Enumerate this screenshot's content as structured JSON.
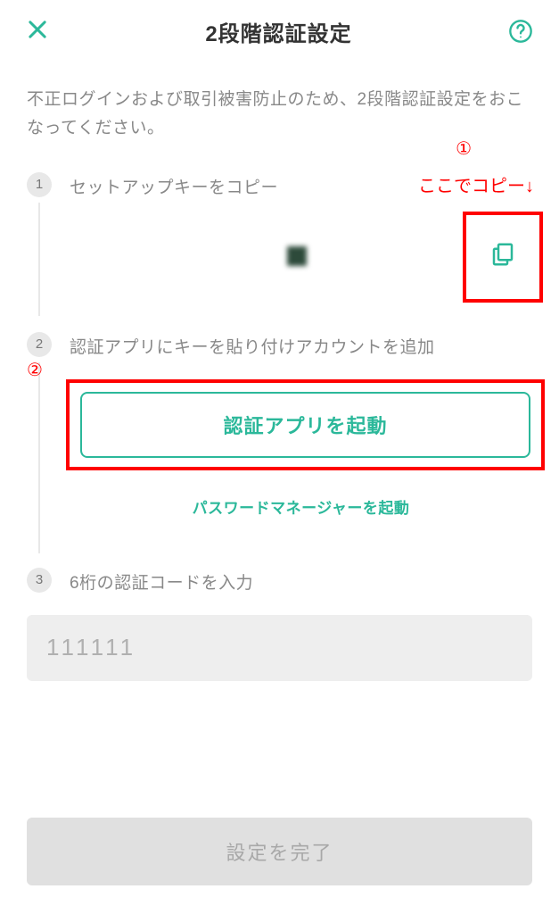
{
  "header": {
    "title": "2段階認証設定"
  },
  "intro": "不正ログインおよび取引被害防止のため、2段階認証設定をおこなってください。",
  "annotations": {
    "circled1": "①",
    "copy_here": "ここでコピー↓",
    "circled2": "②"
  },
  "steps": {
    "s1": {
      "num": "1",
      "title": "セットアップキーをコピー"
    },
    "s2": {
      "num": "2",
      "title": "認証アプリにキーを貼り付けアカウントを追加",
      "launch_button": "認証アプリを起動",
      "password_manager": "パスワードマネージャーを起動"
    },
    "s3": {
      "num": "3",
      "title": "6桁の認証コードを入力",
      "placeholder": "111111"
    }
  },
  "submit": {
    "label": "設定を完了"
  },
  "colors": {
    "accent": "#2bb89a",
    "annotation": "#ff0000"
  }
}
